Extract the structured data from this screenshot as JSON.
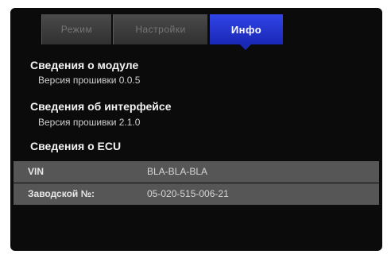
{
  "tabs": {
    "mode_label": "Режим",
    "settings_label": "Настройки",
    "info_label": "Инфо",
    "active": "info"
  },
  "module": {
    "title": "Сведения о модуле",
    "firmware": "Версия прошивки 0.0.5"
  },
  "interface": {
    "title": "Сведения об интерфейсе",
    "firmware": "Версия прошивки 2.1.0"
  },
  "ecu": {
    "title": "Сведения о ECU",
    "vin_label": "VIN",
    "vin_value": "BLA-BLA-BLA",
    "serial_label": "Заводской №:",
    "serial_value": "05-020-515-006-21"
  },
  "colors": {
    "active_tab": "#2233d6",
    "background": "#0b0b0b",
    "row_background": "#565656"
  }
}
